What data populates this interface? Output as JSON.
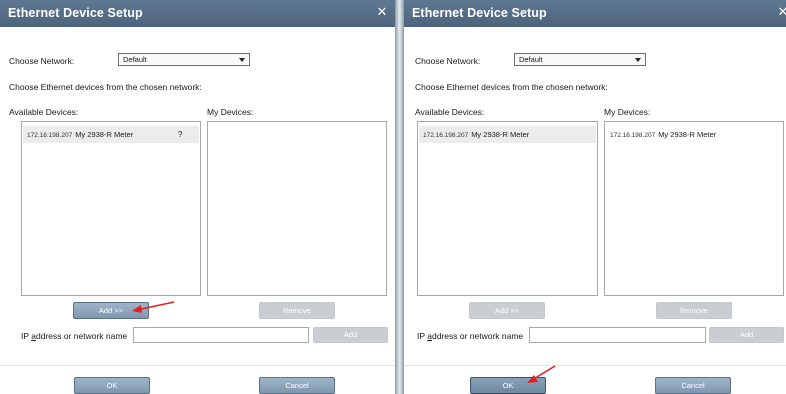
{
  "dialogs": [
    {
      "title": "Ethernet Device Setup",
      "choose_network_label": "Choose Network:",
      "network_value": "Default",
      "instruction": "Choose Ethernet devices from the chosen network:",
      "available_label": "Available Devices:",
      "my_devices_label": "My Devices:",
      "available_devices": [
        {
          "ip": "172.16.198.207",
          "name": "My 2938-R Meter"
        }
      ],
      "my_devices": [],
      "add_button": "Add >>",
      "remove_button": "Remove",
      "ip_label": "IP address or network name",
      "ip_label_accel": "a",
      "ip_label_rest": "ddress or network name",
      "ip_label_prefix": "IP ",
      "ip_value": "",
      "add_ip_button": "Add",
      "ok_button": "OK",
      "cancel_button": "Cancel",
      "cursor_glyph": "?"
    },
    {
      "title": "Ethernet Device Setup",
      "choose_network_label": "Choose Network:",
      "network_value": "Default",
      "instruction": "Choose Ethernet devices from the chosen network:",
      "available_label": "Available Devices:",
      "my_devices_label": "My Devices:",
      "available_devices": [
        {
          "ip": "172.16.198.207",
          "name": "My 2938-R Meter"
        }
      ],
      "my_devices": [
        {
          "ip": "172.16.198.207",
          "name": "My 2938-R Meter"
        }
      ],
      "add_button": "Add >>",
      "remove_button": "Remove",
      "ip_label_prefix": "IP ",
      "ip_label_accel": "a",
      "ip_label_rest": "ddress or network name",
      "ip_value": "",
      "add_ip_button": "Add",
      "ok_button": "OK",
      "cancel_button": "Cancel"
    }
  ],
  "colors": {
    "titlebar": "#56708a",
    "button_active": "#8ea6bd",
    "button_disabled": "#c9ced3",
    "annotation_arrow": "#e02020"
  },
  "icons": {
    "close": "close-icon",
    "dropdown": "chevron-down-icon",
    "annotation": "red-arrow-annotation"
  }
}
